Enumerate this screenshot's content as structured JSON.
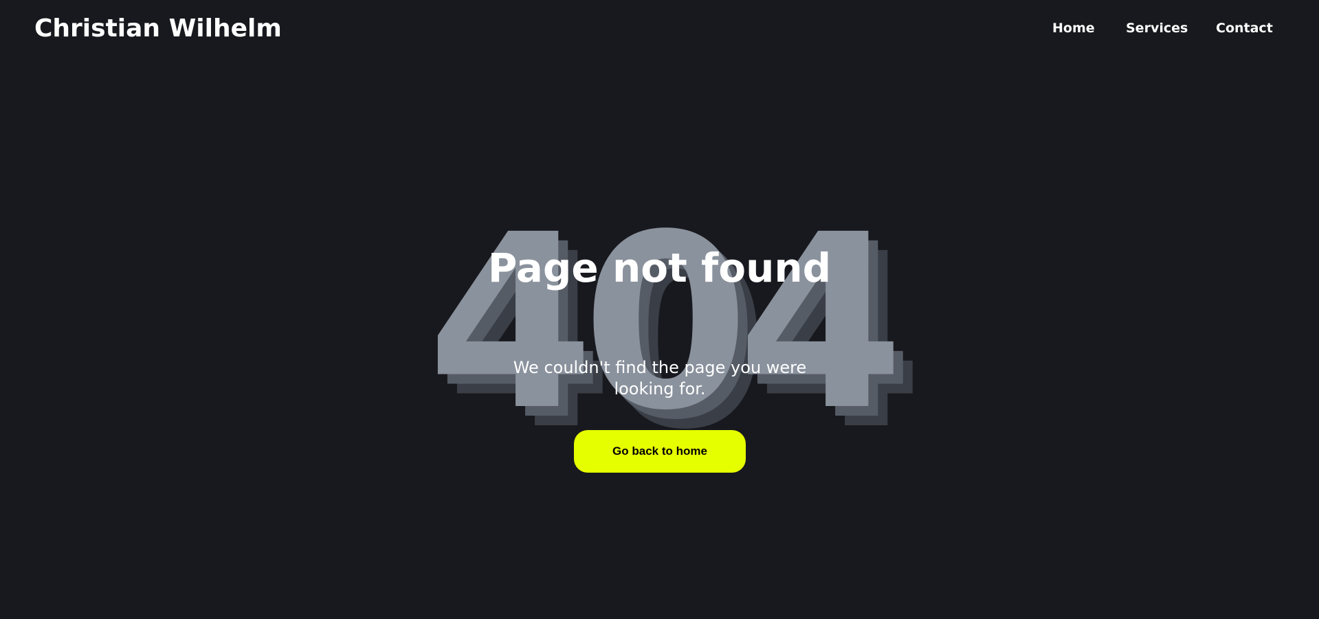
{
  "header": {
    "brand": "Christian Wilhelm",
    "nav": [
      {
        "label": "Home"
      },
      {
        "label": "Services"
      },
      {
        "label": "Contact"
      }
    ]
  },
  "error": {
    "code": "404",
    "title": "Page not found",
    "message": "We couldn't find the page you were looking for.",
    "button_label": "Go back to home"
  },
  "colors": {
    "background": "#18191e",
    "accent": "#e6ff00",
    "code_front": "#8a929d",
    "code_shadow_1": "#565c66",
    "code_shadow_2": "#3a3e47",
    "text": "#ffffff"
  }
}
